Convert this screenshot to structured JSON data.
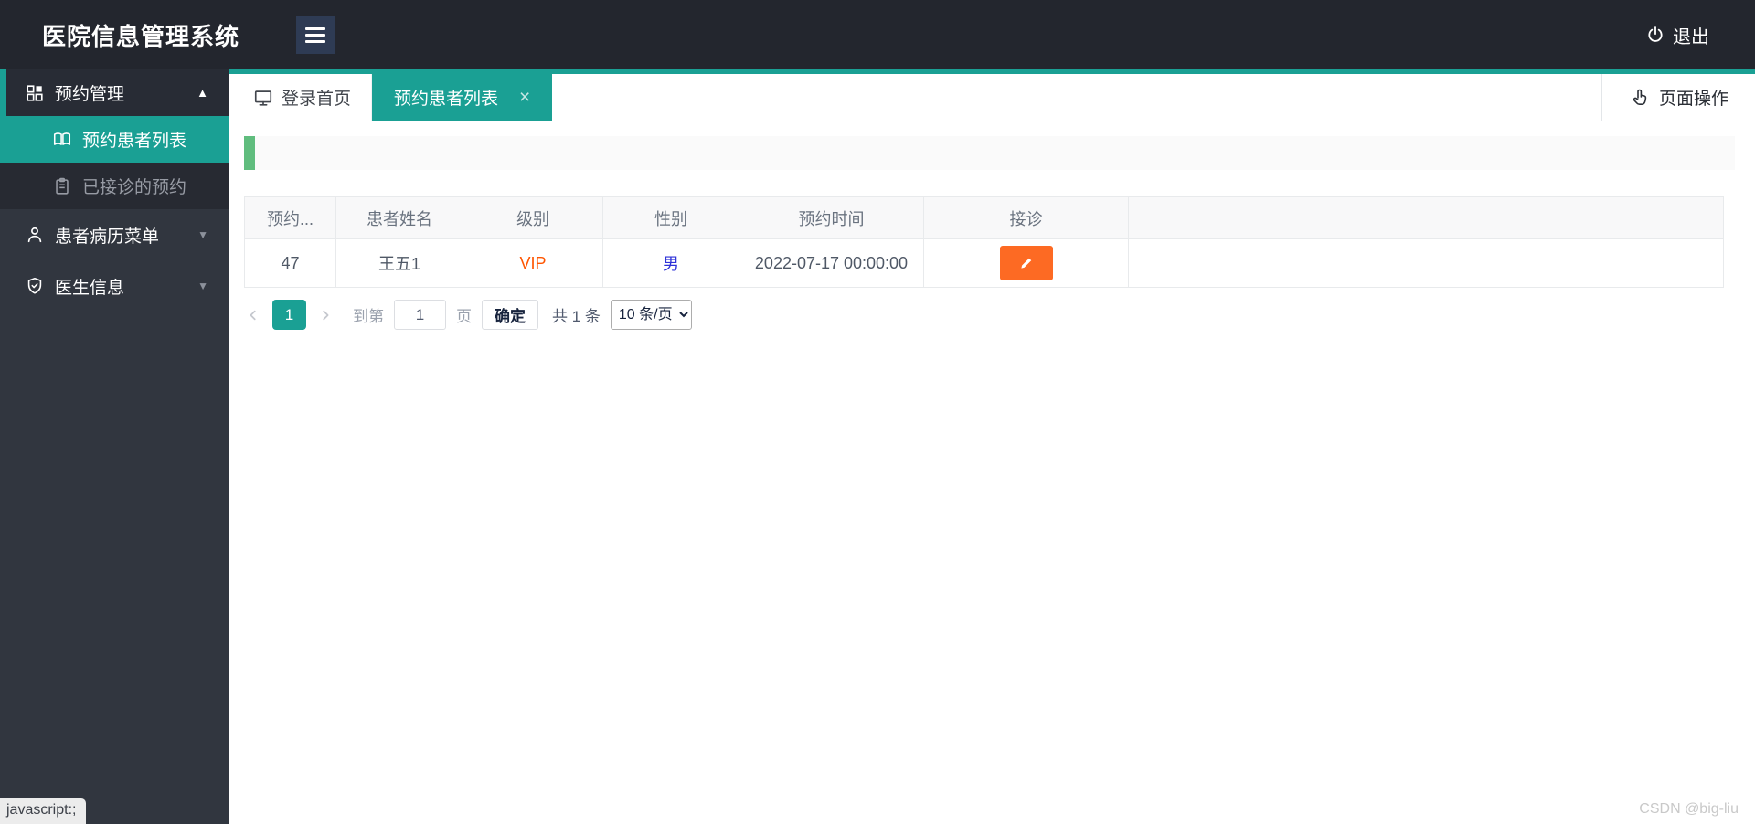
{
  "header": {
    "title": "医院信息管理系统",
    "logout_label": "退出"
  },
  "sidebar": {
    "items": [
      {
        "label": "预约管理",
        "icon": "grid-icon",
        "state": "expanded",
        "arrow": "▲",
        "children": [
          {
            "label": "预约患者列表",
            "icon": "book-icon",
            "active": true
          },
          {
            "label": "已接诊的预约",
            "icon": "clipboard-icon",
            "active": false
          }
        ]
      },
      {
        "label": "患者病历菜单",
        "icon": "user-icon",
        "state": "collapsed",
        "arrow": "▼"
      },
      {
        "label": "医生信息",
        "icon": "shield-check-icon",
        "state": "collapsed",
        "arrow": "▼"
      }
    ]
  },
  "tabbar": {
    "tabs": [
      {
        "label": "登录首页",
        "icon": "monitor-icon",
        "active": false
      },
      {
        "label": "预约患者列表",
        "active": true,
        "close_icon": "×"
      }
    ],
    "page_actions_label": "页面操作",
    "page_actions_icon": "hand-pointer-icon"
  },
  "table": {
    "columns": [
      "预约...",
      "患者姓名",
      "级别",
      "性别",
      "预约时间",
      "接诊"
    ],
    "rows": [
      {
        "id": "47",
        "name": "王五1",
        "level": "VIP",
        "gender": "男",
        "time": "2022-07-17 00:00:00",
        "action_icon": "pencil-icon"
      }
    ]
  },
  "pagination": {
    "current_page": "1",
    "goto_prefix": "到第",
    "goto_value": "1",
    "goto_suffix": "页",
    "confirm_label": "确定",
    "total_label": "共 1 条",
    "page_size_label": "10 条/页"
  },
  "footer": {
    "status_text": "javascript:;",
    "watermark": "CSDN @big-liu"
  },
  "colors": {
    "teal_accent": "#1aa094",
    "header_bg": "#23262e",
    "sidebar_bg": "#31363f",
    "submenu_bg": "#272a32",
    "green_accent": "#60bd7e",
    "action_orange": "#fd6a23",
    "vip_text": "#ff5500",
    "gender_text": "#2e32d8"
  }
}
